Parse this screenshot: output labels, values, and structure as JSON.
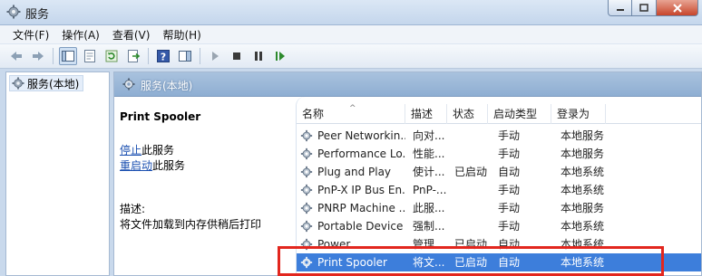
{
  "window": {
    "title": "服务",
    "icon": "gear-icon",
    "controls": {
      "minimize": "minimize-icon",
      "maximize": "maximize-icon",
      "close": "close-icon"
    }
  },
  "menu": [
    "文件(F)",
    "操作(A)",
    "查看(V)",
    "帮助(H)"
  ],
  "toolbar": {
    "icons": [
      "back-arrow-icon",
      "forward-arrow-icon",
      "show-console-tree-icon",
      "properties-icon",
      "refresh-icon",
      "export-list-icon",
      "help-icon",
      "show-action-pane-icon",
      "start-service-icon",
      "stop-service-icon",
      "pause-service-icon",
      "restart-service-icon"
    ]
  },
  "tree": {
    "item": "服务(本地)"
  },
  "main": {
    "header": "服务(本地)",
    "selected_service": "Print Spooler",
    "stop_link": "停止",
    "stop_suffix": "此服务",
    "restart_link": "重启动",
    "restart_suffix": "此服务",
    "desc_label": "描述:",
    "desc_text": "将文件加载到内存供稍后打印"
  },
  "list": {
    "columns": [
      "名称",
      "描述",
      "状态",
      "启动类型",
      "登录为"
    ],
    "rows": [
      {
        "name": "Peer Networkin...",
        "desc": "向对...",
        "status": "",
        "startup": "手动",
        "logon": "本地服务"
      },
      {
        "name": "Performance Lo...",
        "desc": "性能...",
        "status": "",
        "startup": "手动",
        "logon": "本地服务"
      },
      {
        "name": "Plug and Play",
        "desc": "使计...",
        "status": "已启动",
        "startup": "自动",
        "logon": "本地系统"
      },
      {
        "name": "PnP-X IP Bus En...",
        "desc": "PnP-...",
        "status": "",
        "startup": "手动",
        "logon": "本地系统"
      },
      {
        "name": "PNRP Machine ...",
        "desc": "此服...",
        "status": "",
        "startup": "手动",
        "logon": "本地服务"
      },
      {
        "name": "Portable Device ...",
        "desc": "强制...",
        "status": "",
        "startup": "手动",
        "logon": "本地系统"
      },
      {
        "name": "Power",
        "desc": "管理...",
        "status": "已启动",
        "startup": "自动",
        "logon": "本地系统"
      },
      {
        "name": "Print Spooler",
        "desc": "将文...",
        "status": "已启动",
        "startup": "自动",
        "logon": "本地系统"
      }
    ],
    "selected_index": 7
  },
  "colors": {
    "selection": "#3d7edb",
    "highlight_box": "#e2261e",
    "header_bg": "#9bb7d8"
  }
}
